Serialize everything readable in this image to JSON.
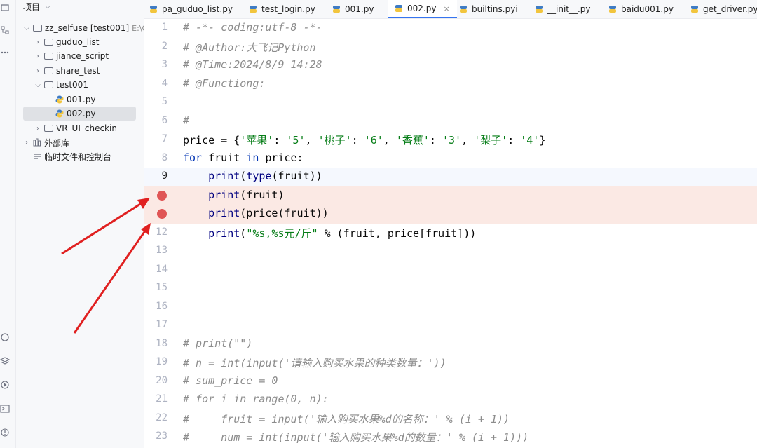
{
  "project_panel": {
    "title": "项目",
    "tree": [
      {
        "label": "zz_selfuse [test001]",
        "hint": "E:\\C",
        "depth": 0,
        "kind": "folder",
        "expanded": true
      },
      {
        "label": "guduo_list",
        "depth": 1,
        "kind": "folder",
        "expanded": false
      },
      {
        "label": "jiance_script",
        "depth": 1,
        "kind": "folder",
        "expanded": false
      },
      {
        "label": "share_test",
        "depth": 1,
        "kind": "folder",
        "expanded": false
      },
      {
        "label": "test001",
        "depth": 1,
        "kind": "folder",
        "expanded": true
      },
      {
        "label": "001.py",
        "depth": 2,
        "kind": "python"
      },
      {
        "label": "002.py",
        "depth": 2,
        "kind": "python",
        "selected": true
      },
      {
        "label": "VR_UI_checkin",
        "depth": 1,
        "kind": "folder",
        "expanded": false
      },
      {
        "label": "外部库",
        "depth": 0,
        "kind": "library",
        "expanded": false
      },
      {
        "label": "临时文件和控制台",
        "depth": 0,
        "kind": "scratch"
      }
    ]
  },
  "tabs": [
    {
      "label": "pa_guduo_list.py"
    },
    {
      "label": "test_login.py"
    },
    {
      "label": "001.py"
    },
    {
      "label": "002.py",
      "active": true
    },
    {
      "label": "builtins.pyi"
    },
    {
      "label": "__init__.py"
    },
    {
      "label": "baidu001.py"
    },
    {
      "label": "get_driver.py"
    }
  ],
  "editor": {
    "current_line": 9,
    "breakpoint_lines": [
      10,
      11
    ],
    "lines": [
      {
        "n": "1",
        "text": "# -*- coding:utf-8 -*-"
      },
      {
        "n": "2",
        "text": "# @Author:大飞记Python"
      },
      {
        "n": "3",
        "text": "# @Time:2024/8/9 14:28"
      },
      {
        "n": "4",
        "text": "# @Functiong:"
      },
      {
        "n": "5",
        "text": ""
      },
      {
        "n": "6",
        "text": "#"
      },
      {
        "n": "7",
        "text": "price = {'苹果': '5', '桃子': '6', '香蕉': '3', '梨子': '4'}"
      },
      {
        "n": "8",
        "text": "for fruit in price:"
      },
      {
        "n": "9",
        "text": "    print(type(fruit))"
      },
      {
        "n": "",
        "text": "    print(fruit)"
      },
      {
        "n": "",
        "text": "    print(price(fruit))"
      },
      {
        "n": "12",
        "text": "    print(\"%s,%s元/斤\" % (fruit, price[fruit]))"
      },
      {
        "n": "13",
        "text": ""
      },
      {
        "n": "14",
        "text": ""
      },
      {
        "n": "15",
        "text": ""
      },
      {
        "n": "16",
        "text": ""
      },
      {
        "n": "17",
        "text": ""
      },
      {
        "n": "18",
        "text": "# print(\"\")"
      },
      {
        "n": "19",
        "text": "# n = int(input('请输入购买水果的种类数量：'))"
      },
      {
        "n": "20",
        "text": "# sum_price = 0"
      },
      {
        "n": "21",
        "text": "# for i in range(0, n):"
      },
      {
        "n": "22",
        "text": "#     fruit = input('输入购买水果%d的名称：' % (i + 1))"
      },
      {
        "n": "23",
        "text": "#     num = int(input('输入购买水果%d的数量：' % (i + 1)))"
      }
    ]
  },
  "colors": {
    "breakpoint": "#e05555",
    "breakpoint_line_bg": "#fbe9e4",
    "annotation_arrow": "#e02020",
    "active_tab_underline": "#3574f0"
  }
}
